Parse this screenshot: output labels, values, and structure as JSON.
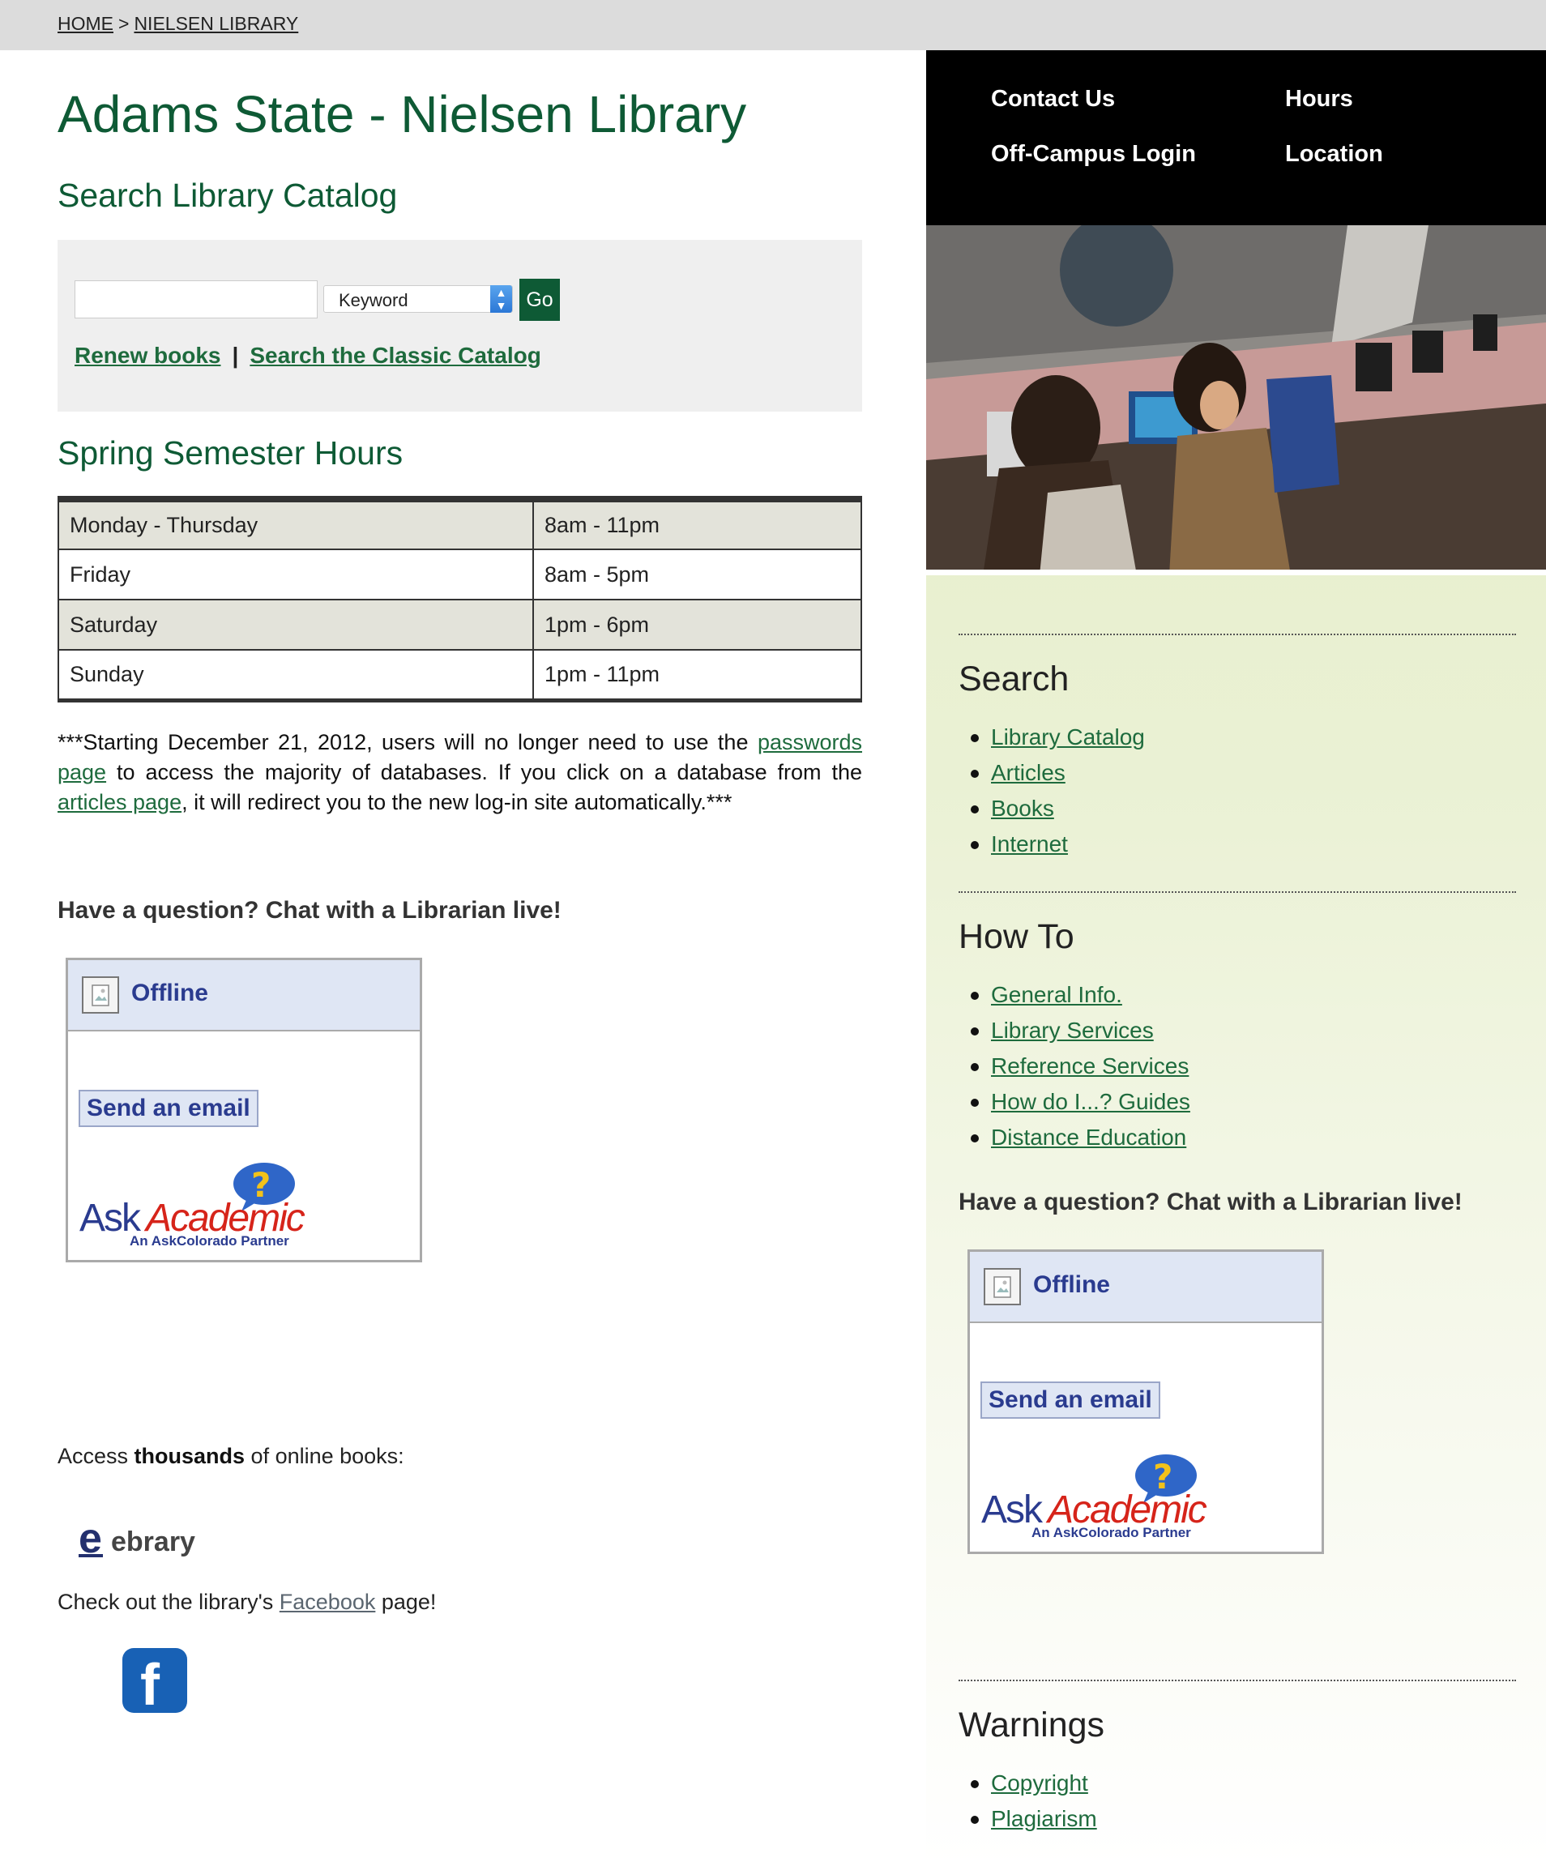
{
  "breadcrumb": {
    "home": "HOME",
    "separator": ">",
    "current": "NIELSEN LIBRARY"
  },
  "main": {
    "title": "Adams State - Nielsen Library",
    "search_heading": "Search Library Catalog",
    "search": {
      "input_value": "",
      "select_value": "Keyword",
      "go_label": "Go",
      "renew_link": "Renew books",
      "pipe": "|",
      "classic_link": "Search the Classic Catalog"
    },
    "hours_heading": "Spring Semester Hours",
    "hours": [
      {
        "day": "Monday - Thursday",
        "time": "8am - 11pm"
      },
      {
        "day": "Friday",
        "time": "8am - 5pm"
      },
      {
        "day": "Saturday",
        "time": "1pm - 6pm"
      },
      {
        "day": "Sunday",
        "time": "1pm - 11pm"
      }
    ],
    "notice": {
      "part1": "***Starting December 21, 2012, users will no longer need to use the ",
      "link1": "passwords page",
      "part2": " to access the majority of databases. If you click on a database from the ",
      "link2": "articles page",
      "part3": ", it will redirect you to the new log-in site automatically.***"
    },
    "chat_heading": "Have a question? Chat with a Librarian live!",
    "access_text_1": "Access ",
    "access_bold": "thousands",
    "access_text_2": " of online books:",
    "ebrary_label": "ebrary",
    "facebook_text_1": "Check out the library's ",
    "facebook_link": "Facebook",
    "facebook_text_2": " page!",
    "facebook_logo_glyph": "f"
  },
  "chat_widget": {
    "status": "Offline",
    "send_label": "Send an email",
    "logo_ask": "Ask",
    "logo_academic": "Academic",
    "logo_tagline": "An AskColorado Partner"
  },
  "side": {
    "nav": {
      "contact": "Contact Us",
      "hours": "Hours",
      "offcampus": "Off-Campus Login",
      "location": "Location"
    },
    "search_heading": "Search",
    "search_links": [
      "Library Catalog",
      "Articles",
      "Books",
      "Internet"
    ],
    "howto_heading": "How To",
    "howto_links": [
      "General Info.",
      "Library Services",
      "Reference Services",
      "How do I...? Guides",
      "Distance Education"
    ],
    "chat_heading": "Have a question? Chat with a Librarian live!",
    "warnings_heading": "Warnings",
    "warnings_links": [
      "Copyright",
      "Plagiarism"
    ]
  },
  "colors": {
    "brand_green": "#0e5a35",
    "link_green": "#1e6b3d",
    "widget_blue": "#2a3b8f",
    "facebook_blue": "#1861b5"
  }
}
